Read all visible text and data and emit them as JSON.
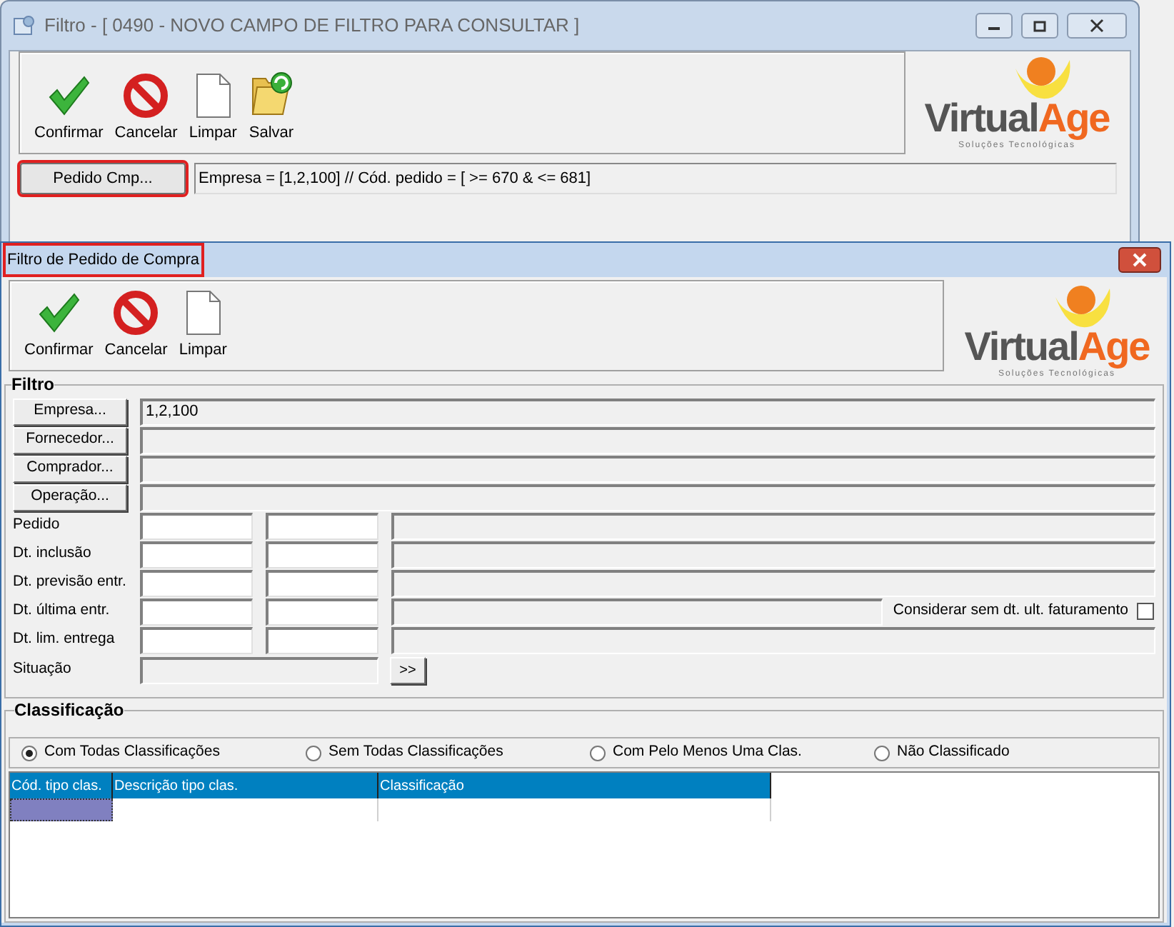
{
  "back_window": {
    "title": "Filtro - [ 0490 - NOVO CAMPO DE FILTRO PARA CONSULTAR ]",
    "toolbar": [
      {
        "kind": "confirm",
        "label": "Confirmar"
      },
      {
        "kind": "cancel",
        "label": "Cancelar"
      },
      {
        "kind": "clear",
        "label": "Limpar"
      },
      {
        "kind": "save",
        "label": "Salvar"
      }
    ],
    "logo": {
      "word_1": "Virtual",
      "word_2": "Age",
      "tagline": "Soluções Tecnológicas"
    },
    "filter_button": {
      "label": "Pedido Cmp...",
      "highlighted": true
    },
    "filter_summary": "Empresa = [1,2,100] // Cód. pedido = [ >= 670 & <= 681]"
  },
  "dialog": {
    "title": "Filtro de Pedido de Compra",
    "title_highlighted": true,
    "toolbar": [
      {
        "kind": "confirm",
        "label": "Confirmar"
      },
      {
        "kind": "cancel",
        "label": "Cancelar"
      },
      {
        "kind": "clear",
        "label": "Limpar"
      }
    ],
    "logo": {
      "word_1": "Virtual",
      "word_2": "Age",
      "tagline": "Soluções Tecnológicas"
    },
    "filter": {
      "title": "Filtro",
      "lookups": [
        {
          "label": "Empresa...",
          "value": "1,2,100"
        },
        {
          "label": "Fornecedor..."
        },
        {
          "label": "Comprador..."
        },
        {
          "label": "Operação..."
        }
      ],
      "ranges": [
        {
          "label": "Pedido"
        },
        {
          "label": "Dt. inclusão"
        },
        {
          "label": "Dt. previsão entr."
        },
        {
          "label": "Dt. última entr.",
          "checkbox": {
            "label": "Considerar sem dt. ult. faturamento",
            "checked": false
          }
        },
        {
          "label": "Dt. lim. entrega"
        }
      ],
      "situation": {
        "label": "Situação",
        "button": ">>"
      }
    },
    "classification": {
      "title": "Classificação",
      "options": [
        {
          "label": "Com Todas Classificações",
          "selected": true
        },
        {
          "label": "Sem Todas Classificações",
          "selected": false
        },
        {
          "label": "Com Pelo Menos Uma Clas.",
          "selected": false
        },
        {
          "label": "Não Classificado",
          "selected": false
        }
      ],
      "table": {
        "columns": [
          "Cód. tipo clas.",
          "Descrição tipo clas.",
          "Classificação"
        ]
      }
    }
  }
}
